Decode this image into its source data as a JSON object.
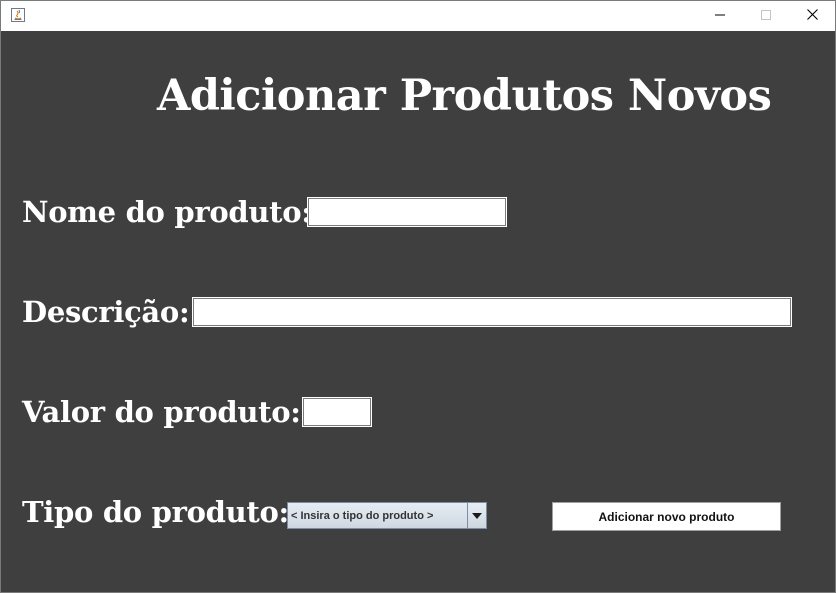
{
  "window": {
    "min_icon": "minimize-icon",
    "max_icon": "maximize-icon",
    "close_icon": "close-icon",
    "app_icon": "java-icon"
  },
  "colors": {
    "background": "#3f3f3f",
    "text": "#ffffff",
    "field": "#ffffff"
  },
  "form": {
    "title": "Adicionar Produtos Novos",
    "name_label": "Nome do produto:",
    "name_value": "",
    "description_label": "Descrição:",
    "description_value": "",
    "price_label": "Valor do produto:",
    "price_value": "",
    "type_label": "Tipo do produto:",
    "type_selected": "< Insira o tipo do produto >",
    "submit_label": "Adicionar novo produto"
  }
}
